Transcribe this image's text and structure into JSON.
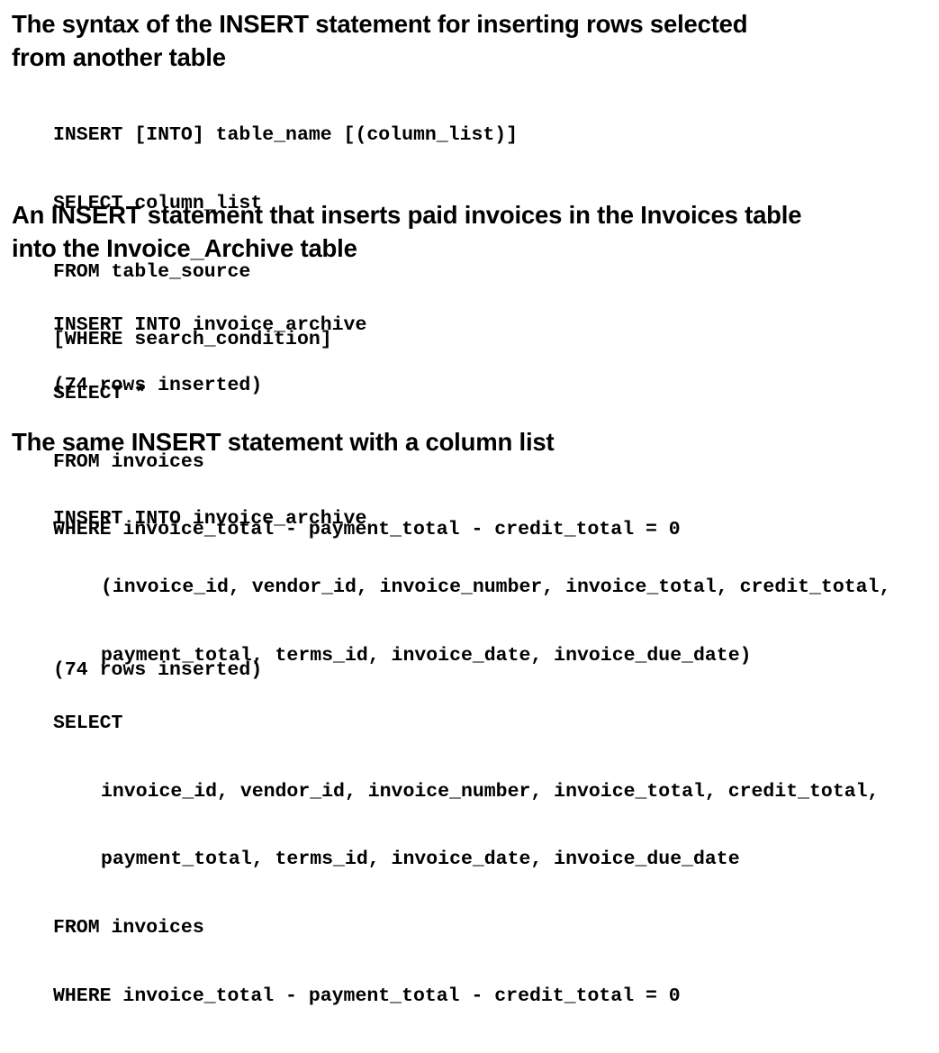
{
  "sections": [
    {
      "heading": [
        "The syntax of the INSERT statement for inserting rows selected",
        "from another table"
      ],
      "code": [
        "INSERT [INTO] table_name [(column_list)]",
        "SELECT column_list",
        "FROM table_source",
        "[WHERE search_condition]"
      ]
    },
    {
      "heading": [
        "An INSERT statement that inserts paid invoices in the Invoices table",
        "into the Invoice_Archive table"
      ],
      "code": [
        "INSERT INTO invoice_archive",
        "SELECT *",
        "FROM invoices",
        "WHERE invoice_total - payment_total - credit_total = 0"
      ],
      "result": "(74 rows inserted)"
    },
    {
      "heading": [
        "The same INSERT statement with a column list"
      ],
      "code": [
        "INSERT INTO invoice_archive",
        "(invoice_id, vendor_id, invoice_number, invoice_total, credit_total,",
        "payment_total, terms_id, invoice_date, invoice_due_date)",
        "SELECT",
        "invoice_id, vendor_id, invoice_number, invoice_total, credit_total,",
        "payment_total, terms_id, invoice_date, invoice_due_date",
        "FROM invoices",
        "WHERE invoice_total - payment_total - credit_total = 0"
      ],
      "result": "(74 rows inserted)"
    }
  ]
}
